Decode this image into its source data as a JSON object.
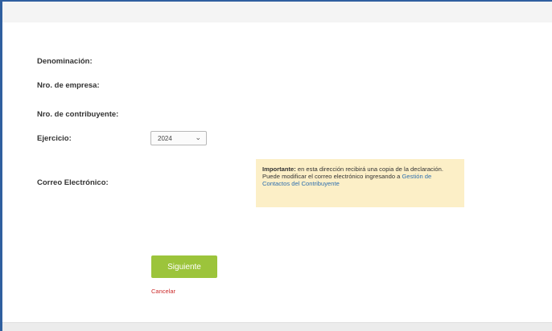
{
  "form": {
    "denominacion_label": "Denominación:",
    "nro_empresa_label": "Nro. de empresa:",
    "nro_contribuyente_label": "Nro. de contribuyente:",
    "ejercicio_label": "Ejercicio:",
    "ejercicio_value": "2024",
    "correo_label": "Correo Electrónico:"
  },
  "notice": {
    "strong": "Importante:",
    "text1": " en esta dirección recibirá una copia de la declaración.",
    "text2": "Puede modificar el correo electrónico ingresando a ",
    "link": "Gestión de Contactos del Contribuyente"
  },
  "actions": {
    "siguiente_label": "Siguiente",
    "cancelar_label": "Cancelar"
  },
  "colors": {
    "frame_border": "#2f5f9f",
    "button_green": "#9cc43b",
    "notice_bg": "#fcefc7",
    "cancel_red": "#cc2b2b",
    "link_blue": "#2f6fae"
  }
}
